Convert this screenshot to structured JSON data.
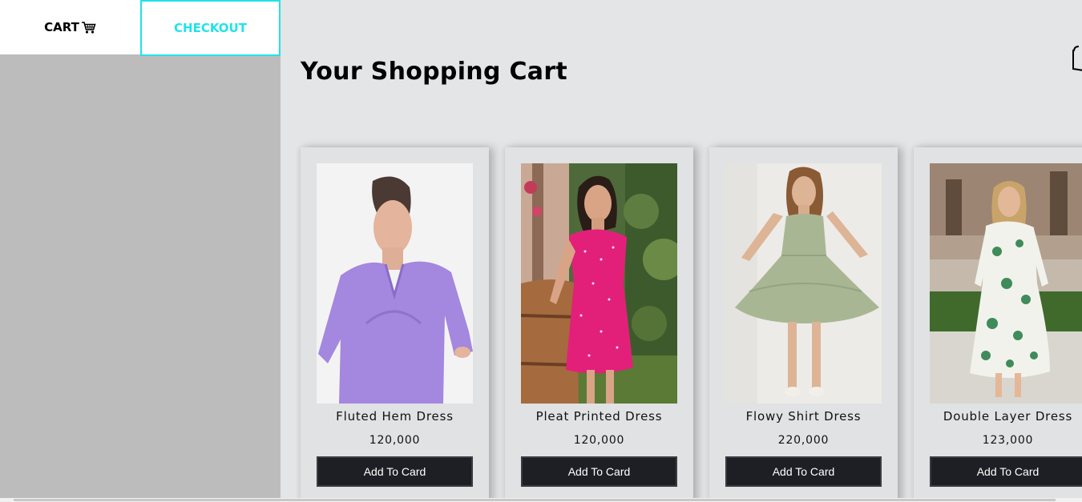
{
  "nav": {
    "cart_label": "CART",
    "checkout_label": "CHECKOUT",
    "checkout_color": "#1fe3ea",
    "cart_icon": "shopping-cart-icon"
  },
  "main": {
    "title": "Your Shopping Cart",
    "bag_icon": "shopping-bag-icon"
  },
  "products": [
    {
      "name": "Fluted Hem Dress",
      "price": "120,000",
      "button_label": "Add To Card",
      "image": "lavender dress photo"
    },
    {
      "name": "Pleat Printed Dress",
      "price": "120,000",
      "button_label": "Add To Card",
      "image": "pink floral dress photo"
    },
    {
      "name": "Flowy Shirt Dress",
      "price": "220,000",
      "button_label": "Add To Card",
      "image": "sage green dress photo"
    },
    {
      "name": "Double Layer Dress",
      "price": "123,000",
      "button_label": "Add To Card",
      "image": "white floral maxi dress photo"
    }
  ],
  "colors": {
    "sidebar_bg": "#bcbcbc",
    "main_bg": "#e3e5e6",
    "button_bg": "#1d1f24"
  }
}
